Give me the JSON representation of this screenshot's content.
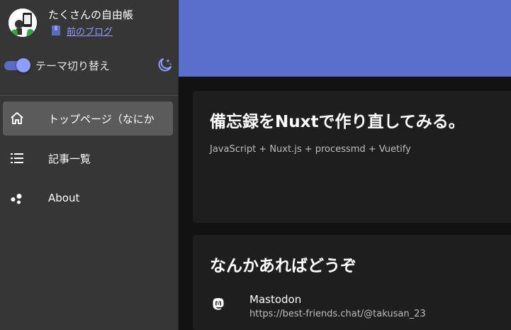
{
  "site": {
    "title": "たくさんの自由帳",
    "blog_link_label": "前のブログ",
    "avatar_icon": "avatar-image",
    "blog_icon": "bookmark-icon"
  },
  "theme": {
    "label": "テーマ切り替え",
    "dark_enabled": true,
    "icon": "moon-stars-icon"
  },
  "nav": {
    "items": [
      {
        "label": "トップページ（なにか",
        "icon": "home-icon",
        "active": true
      },
      {
        "label": "記事一覧",
        "icon": "list-icon",
        "active": false
      },
      {
        "label": "About",
        "icon": "dots-icon",
        "active": false
      }
    ]
  },
  "main": {
    "cards": [
      {
        "title": "備忘録をNuxtで作り直してみる。",
        "subtitle": "JavaScript + Nuxt.js + processmd + Vuetify"
      },
      {
        "title": "なんかあればどうぞ",
        "links": [
          {
            "name": "Mastodon",
            "url": "https://best-friends.chat/@takusan_23",
            "icon": "mastodon-icon"
          }
        ]
      }
    ]
  },
  "colors": {
    "hero": "#5a6fcc",
    "sidebar": "#363636",
    "background": "#121212",
    "card": "#1e1e1e",
    "accent": "#8c9eff"
  }
}
